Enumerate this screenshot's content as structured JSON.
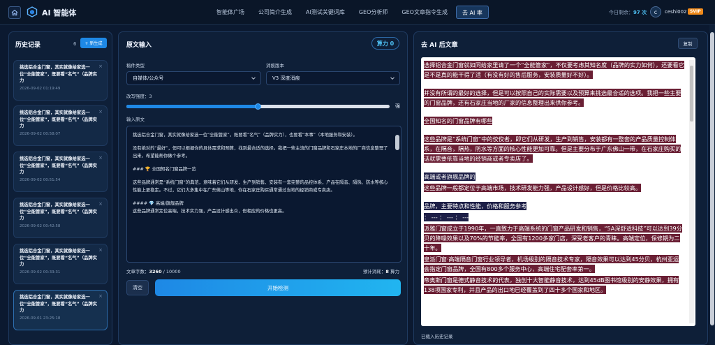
{
  "nav": {
    "brand": "AI 智能体",
    "links": [
      "智能体广场",
      "公司简介生成",
      "AI测试关键词库",
      "GEO分析师",
      "GEO文章指令生成",
      "去 AI 率"
    ],
    "remain_label": "今日剩余：",
    "remain_value": "97 次",
    "avatar_letter": "c",
    "username": "ceshi002",
    "vip": "SVIP"
  },
  "history": {
    "title": "历史记录",
    "count": "6",
    "new_label": "+ 新生成",
    "items": [
      {
        "text": "挑选铝合金门窗，其实就像给家选一位“全能管家”，既要看“名气”（品牌实力",
        "date": "2026-09-02 01:19:49"
      },
      {
        "text": "挑选铝合金门窗，其实就像给家选一位“全能管家”，既要看“名气”（品牌实力",
        "date": "2026-09-02 00:58:07"
      },
      {
        "text": "挑选铝合金门窗，其实就像给家选一位“全能管家”，既要看“名气”（品牌实力",
        "date": "2026-09-02 00:51:54"
      },
      {
        "text": "挑选铝合金门窗，其实就像给家选一位“全能管家”，既要看“名气”（品牌实力",
        "date": "2026-09-02 00:42:58"
      },
      {
        "text": "挑选铝合金门窗，其实就像给家选一位“全能管家”，既要看“名气”（品牌实力",
        "date": "2026-09-02 00:33:31"
      },
      {
        "text": "挑选铝合金门窗，其实就像给家选一位“全能管家”，既要看“名气”（品牌实力",
        "date": "2026-09-01 23:25:18"
      }
    ]
  },
  "input": {
    "title": "原文输入",
    "compute_label": "算力",
    "compute_value": "0",
    "type_label": "稿件类型",
    "type_value": "自媒体/公众号",
    "version_label": "消痕版本",
    "version_value": "V3 深度消痕",
    "strength_label": "改写强度：3",
    "strength_level": 0.5,
    "strength_max_label": "强",
    "text_label": "输入原文",
    "paragraphs": [
      "挑选铝合金门窗，其实就像给家选一位“全能管家”，既要看“名气”（品牌实力），也要看“本事”（本地服务和安装）。",
      "没有绝对的“最好”，但可以根据你的具体需求和预算，找到最合适的选择。我把一些主流的门窗品牌和石家庄本地的厂商信息整理了出来，希望能帮你做个参考。",
      "### 🏆 全国知名门窗品牌一览",
      "这些品牌通常是“系统门窗”的典范，意味着它们从研发、生产到销售、安装有一套完整的品控体系，产品在隔音、隔热、防水等核心性能上更稳定。不过，它们大多集中在广东佛山等地，你在石家庄购买通常通过当地的经销商或专卖店。",
      "#### 💎 高端/旗舰品牌\n这些品牌通常定位高端，技术实力强，产品设计感出众，但相应的价格也更高。"
    ],
    "char_label": "文章字数：",
    "char_value": "3260",
    "char_total": " / 10000",
    "cost_label": "预计消耗：",
    "cost_value": "8",
    "cost_unit": " 算力",
    "clear_label": "清空",
    "start_label": "开始检测"
  },
  "output": {
    "title": "去 AI 后文章",
    "copy_label": "复制",
    "lines": [
      {
        "text": "选择铝合金门窗就如同给家里请了一个“全能管家”，不仅要考虑其知名度（品牌的实力如何），还要看它是不是真的能干得了活（有没有好的售后服务，安装质量好不好）。",
        "style": "red",
        "gap": false
      },
      {
        "text": "并没有所谓的最好的选择，但是可以按照自己的实际需要以及预算来挑选最合适的选项。我把一些主要的门窗品牌，还有石家庄当地的厂家的信息整理出来供你参考。",
        "style": "red",
        "gap": true
      },
      {
        "text": "全国知名的门窗品牌有哪些",
        "style": "red",
        "gap": true
      },
      {
        "text": "这些品牌是“系统门窗”中的佼佼者，即它们从研发，生产到销售，安装都有一整套的产品质量控制体系，在隔音，隔热，防水等方面的核心性能更加可靠。但是主要分布于广东佛山一带，在石家庄购买的话就需要依靠当地的经销商或者专卖店了。",
        "style": "red",
        "gap": true
      },
      {
        "text": "高端或者旗舰品牌的",
        "style": "navy",
        "gap": true
      },
      {
        "text": "这些品牌一般都定位于高端市场，技术研发能力强，产品设计感好，但是价格比较高。",
        "style": "red",
        "gap": false
      },
      {
        "text": "品牌，主要特点和性能，价格和服务参考",
        "style": "navy",
        "gap": true
      },
      {
        "text": "： --- ： --- ： ---",
        "style": "navy",
        "gap": false
      },
      {
        "text": "派雅门窗成立于1990年，一直致力于高端系统的门窗产品研发和销售，“5A深舒适科技”可以达到39分贝的降噪效果以及70%的节能率，全国有1200多家门店，深受老客户的青睐。高端定位，保修期为二十年。",
        "style": "red",
        "gap": false
      },
      {
        "text": "皇派门窗·高端隔音门窗行业领导者，机场级别的隔音技术专家，隔音效果可以达到45分贝，杭州亚运会指定门窗品牌，全国有800多个服务中心，高端住宅配套率第一。",
        "style": "red",
        "gap": false
      },
      {
        "text": "帝奥斯门窗是德式静音技术的代表，独创十大智能静音技术，达到45dB图书馆级别的安静效果，拥有138项国家专利，并且产品的出口地已经覆盖到了四十多个国家和地区。",
        "style": "red",
        "gap": false
      }
    ],
    "footer": "已载入历史记录"
  }
}
